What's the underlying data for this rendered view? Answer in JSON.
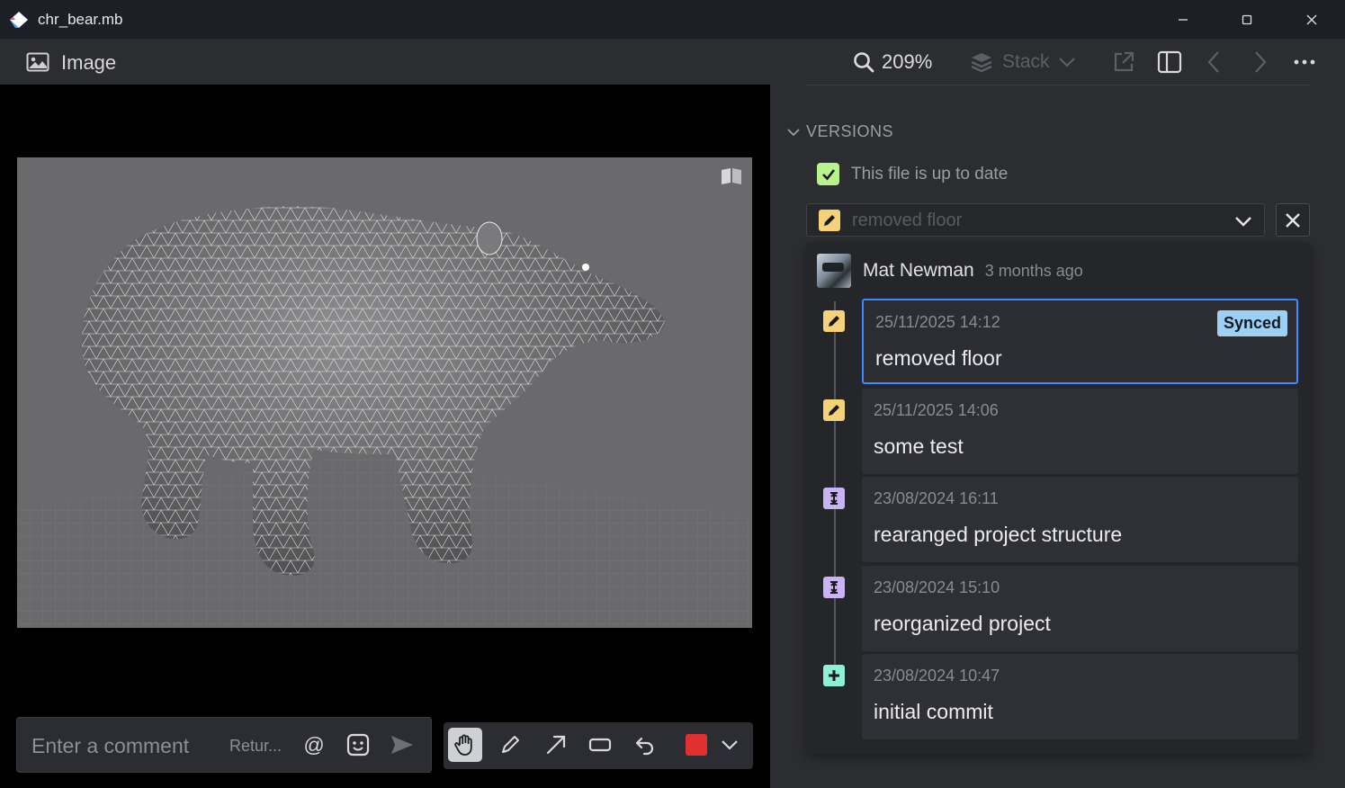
{
  "window": {
    "title": "chr_bear.mb"
  },
  "viewer": {
    "header_label": "Image",
    "comment_placeholder": "Enter a comment",
    "comment_hint": "Retur...",
    "mention_symbol": "@"
  },
  "toolbar": {
    "zoom": "209%",
    "stack_label": "Stack"
  },
  "versions": {
    "section_title": "VERSIONS",
    "status_text": "This file is up to date",
    "selected_version": "removed floor",
    "author": {
      "name": "Mat Newman",
      "time": "3 months ago"
    },
    "items": [
      {
        "date": "25/11/2025 14:12",
        "message": "removed floor",
        "type": "edit",
        "badge": "Synced",
        "selected": true
      },
      {
        "date": "25/11/2025 14:06",
        "message": "some test",
        "type": "edit"
      },
      {
        "date": "23/08/2024 16:11",
        "message": "rearanged project structure",
        "type": "restructure"
      },
      {
        "date": "23/08/2024 15:10",
        "message": "reorganized project",
        "type": "restructure"
      },
      {
        "date": "23/08/2024 10:47",
        "message": "initial commit",
        "type": "add"
      }
    ]
  },
  "colors": {
    "accent_selected": "#3d8bff",
    "edit_icon": "#f3d27a",
    "restructure_icon": "#c9b3f5",
    "add_icon": "#8ff0d8",
    "up_to_date_check": "#b9f28d",
    "synced_badge": "#9ed0f4",
    "draw_color": "#e03030"
  }
}
